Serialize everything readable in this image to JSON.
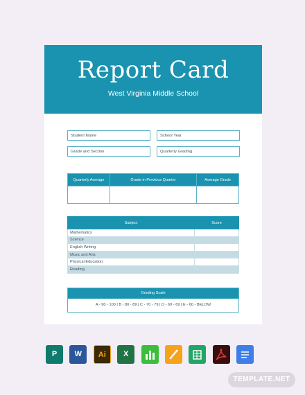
{
  "document": {
    "title": "Report Card",
    "school": "West Virginia Middle School",
    "fields": {
      "student_name": "Student Name",
      "school_year": "School Year",
      "grade_section": "Grade and Section",
      "quarterly_grading": "Quarterly Grading"
    },
    "quarter_table": {
      "headers": [
        "Quarterly Average",
        "Grade in Previous Quarter",
        "Average Grade"
      ]
    },
    "subject_table": {
      "headers": [
        "Subject",
        "Score"
      ],
      "rows": [
        "Mathematics",
        "Science",
        "English Writing",
        "Music and Arts",
        "Physical Education",
        "Reading"
      ]
    },
    "grading_scale": {
      "title": "Grading Scale",
      "text": "A - 90 - 100 | B - 80 - 89 | C - 70 - 79 | D - 60 - 69 | E - 60 - BELOW"
    }
  },
  "format_icons": [
    {
      "name": "publisher-icon",
      "letter": "P",
      "color": "#0f7b6c"
    },
    {
      "name": "word-icon",
      "letter": "W",
      "color": "#2b579a"
    },
    {
      "name": "illustrator-icon",
      "letter": "Ai",
      "color": "#3b2a05"
    },
    {
      "name": "excel-icon",
      "letter": "X",
      "color": "#217346"
    },
    {
      "name": "numbers-icon",
      "letter": "",
      "color": "#3bbf3b"
    },
    {
      "name": "pages-icon",
      "letter": "",
      "color": "#f6a21a"
    },
    {
      "name": "sheets-icon",
      "letter": "",
      "color": "#23a566"
    },
    {
      "name": "pdf-icon",
      "letter": "",
      "color": "#3a0d0d"
    },
    {
      "name": "docs-icon",
      "letter": "",
      "color": "#3f7ee8"
    }
  ],
  "watermark": "TEMPLATE.NET",
  "brand_color": "#1a93b0"
}
